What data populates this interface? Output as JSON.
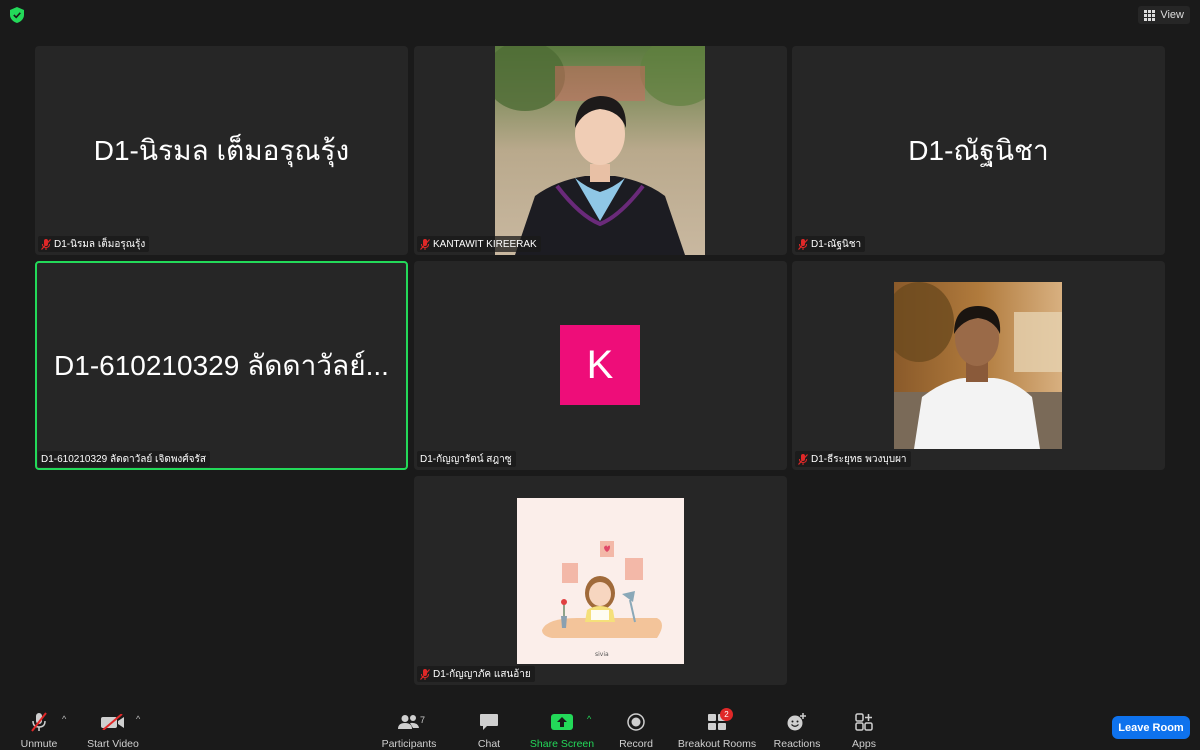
{
  "topbar": {
    "view_label": "View",
    "shield_icon": "security-shield-icon",
    "grid_icon": "grid-view-icon"
  },
  "tiles": [
    {
      "big_name": "D1-นิรมล เต็มอรุณรุ้ง",
      "label": "D1-นิรมล เต็มอรุณรุ้ง",
      "muted": true,
      "kind": "name"
    },
    {
      "big_name": "",
      "label": "KANTAWIT KIREERAK",
      "muted": true,
      "kind": "photo-graduate"
    },
    {
      "big_name": "D1-ณัฐนิชา",
      "label": "D1-ณัฐนิชา",
      "muted": true,
      "kind": "name"
    },
    {
      "big_name": "D1-610210329 ลัดดาวัลย์...",
      "label": "D1-610210329 ลัดดาวัลย์ เจิดพงศ์จรัส",
      "muted": false,
      "kind": "name",
      "active_speaker": true
    },
    {
      "big_name": "",
      "label": "D1-กัญญารัตน์ สฎาซู",
      "muted": false,
      "kind": "avatar",
      "avatar_letter": "K",
      "avatar_color": "#ee0d79"
    },
    {
      "big_name": "",
      "label": "D1-ธีระยุทธ พวงบุบผา",
      "muted": true,
      "kind": "photo-student"
    },
    {
      "big_name": "",
      "label": "D1-กัญญาภัค แสนอ้าย",
      "muted": true,
      "kind": "illustration"
    }
  ],
  "toolbar": {
    "unmute": "Unmute",
    "start_video": "Start Video",
    "participants": "Participants",
    "participants_count": "7",
    "chat": "Chat",
    "share_screen": "Share Screen",
    "record": "Record",
    "breakout_rooms": "Breakout Rooms",
    "breakout_badge": "2",
    "reactions": "Reactions",
    "apps": "Apps",
    "leave_room": "Leave Room"
  },
  "colors": {
    "background": "#1a1a1a",
    "tile": "#262626",
    "active_border": "#23d959",
    "share_green": "#23d959",
    "leave_blue": "#0e72ed",
    "muted_red": "#e02828"
  }
}
